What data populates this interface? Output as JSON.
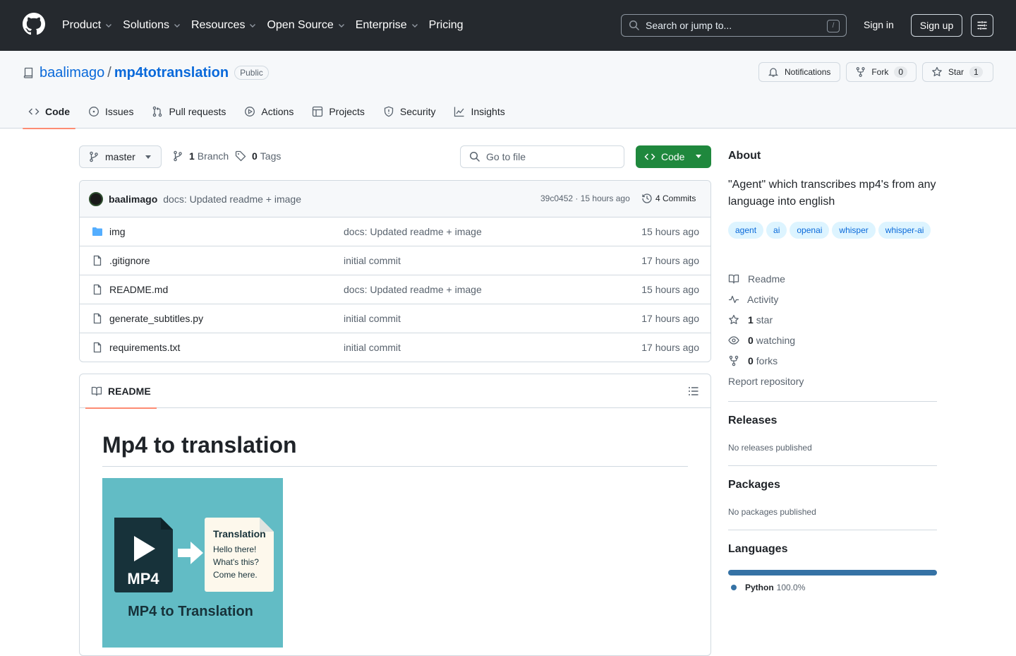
{
  "header": {
    "nav": [
      "Product",
      "Solutions",
      "Resources",
      "Open Source",
      "Enterprise",
      "Pricing"
    ],
    "search_placeholder": "Search or jump to...",
    "search_shortcut": "/",
    "sign_in": "Sign in",
    "sign_up": "Sign up"
  },
  "repo": {
    "owner": "baalimago",
    "name": "mp4totranslation",
    "visibility": "Public",
    "notifications_label": "Notifications",
    "fork_label": "Fork",
    "fork_count": "0",
    "star_label": "Star",
    "star_count": "1",
    "tabs": [
      "Code",
      "Issues",
      "Pull requests",
      "Actions",
      "Projects",
      "Security",
      "Insights"
    ]
  },
  "browser": {
    "branch": "master",
    "branch_count": "1",
    "branch_label": "Branch",
    "tag_count": "0",
    "tag_label": "Tags",
    "go_to_file": "Go to file",
    "code_button": "Code",
    "commit": {
      "author": "baalimago",
      "message": "docs: Updated readme + image",
      "hash_time": "39c0452 · 15 hours ago",
      "commits": "4 Commits"
    },
    "files": [
      {
        "name": "img",
        "type": "dir",
        "message": "docs: Updated readme + image",
        "time": "15 hours ago"
      },
      {
        "name": ".gitignore",
        "type": "file",
        "message": "initial commit",
        "time": "17 hours ago"
      },
      {
        "name": "README.md",
        "type": "file",
        "message": "docs: Updated readme + image",
        "time": "15 hours ago"
      },
      {
        "name": "generate_subtitles.py",
        "type": "file",
        "message": "initial commit",
        "time": "17 hours ago"
      },
      {
        "name": "requirements.txt",
        "type": "file",
        "message": "initial commit",
        "time": "17 hours ago"
      }
    ]
  },
  "readme": {
    "tab": "README",
    "title": "Mp4 to translation",
    "image": {
      "badge": "MP4",
      "card_title": "Translation",
      "card_lines": [
        "Hello there!",
        "What's this?",
        "Come here."
      ],
      "caption": "MP4 to Translation"
    }
  },
  "sidebar": {
    "about_title": "About",
    "description": "\"Agent\" which transcribes mp4's from any language into english",
    "topics": [
      "agent",
      "ai",
      "openai",
      "whisper",
      "whisper-ai"
    ],
    "readme": "Readme",
    "activity": "Activity",
    "stars_count": "1",
    "stars_label": "star",
    "watching_count": "0",
    "watching_label": "watching",
    "forks_count": "0",
    "forks_label": "forks",
    "report": "Report repository",
    "releases_title": "Releases",
    "releases_text": "No releases published",
    "packages_title": "Packages",
    "packages_text": "No packages published",
    "languages_title": "Languages",
    "languages": [
      {
        "name": "Python",
        "percent": "100.0%",
        "color": "#3572a5"
      }
    ]
  },
  "colors": {
    "header_bg": "#25292e",
    "link": "#0969da",
    "primary_button": "#1f883d",
    "tab_underline": "#fd8c73",
    "readme_image_bg": "#62bcc5"
  }
}
